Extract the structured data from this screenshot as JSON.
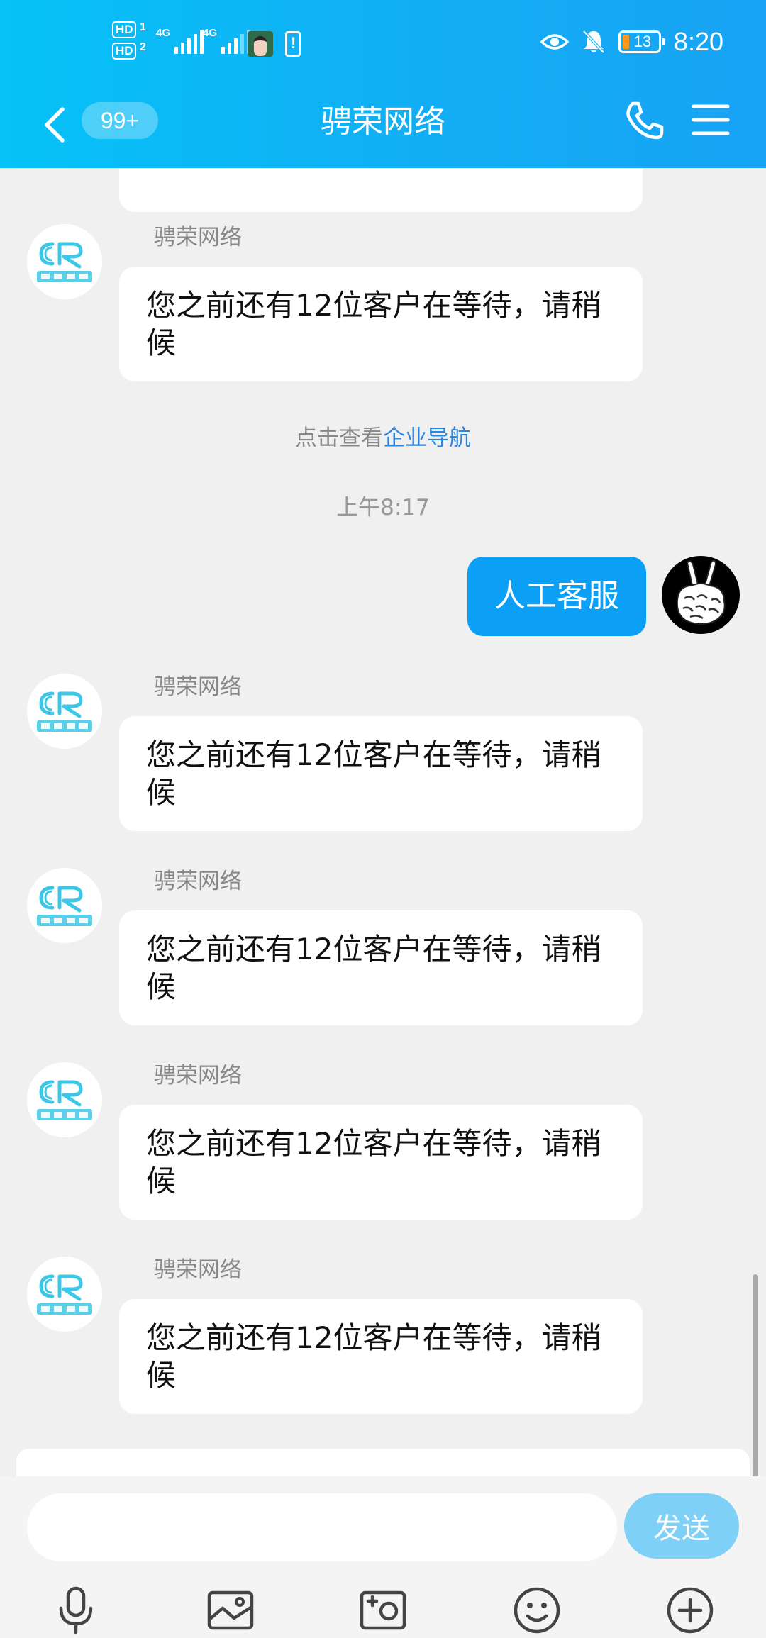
{
  "status_bar": {
    "sim1": "HD",
    "sim1_num": "1",
    "sim2": "HD",
    "sim2_num": "2",
    "network1": "4G",
    "network2": "4G",
    "battery": "13",
    "time": "8:20",
    "icons": [
      "eye-icon",
      "bell-off-icon",
      "battery-icon"
    ]
  },
  "header": {
    "unread_badge": "99+",
    "title": "骋荣网络",
    "icons": [
      "back-arrow-icon",
      "phone-icon",
      "menu-icon"
    ]
  },
  "messages": {
    "sender": "骋荣网络",
    "wait_text": "您之前还有12位客户在等待，请稍候",
    "system_prefix": "点击查看",
    "system_link": "企业导航",
    "timestamp": "上午8:17",
    "outgoing_text": "人工客服"
  },
  "composer": {
    "input_value": "",
    "send_label": "发送",
    "tools": [
      "microphone-icon",
      "image-icon",
      "camera-icon",
      "emoji-icon",
      "plus-icon"
    ]
  },
  "colors": {
    "header_start": "#06c2f6",
    "header_end": "#18a3f4",
    "outgoing_bubble": "#0ba0f5",
    "link": "#2b86e0",
    "send_button": "#7fd0f7"
  }
}
